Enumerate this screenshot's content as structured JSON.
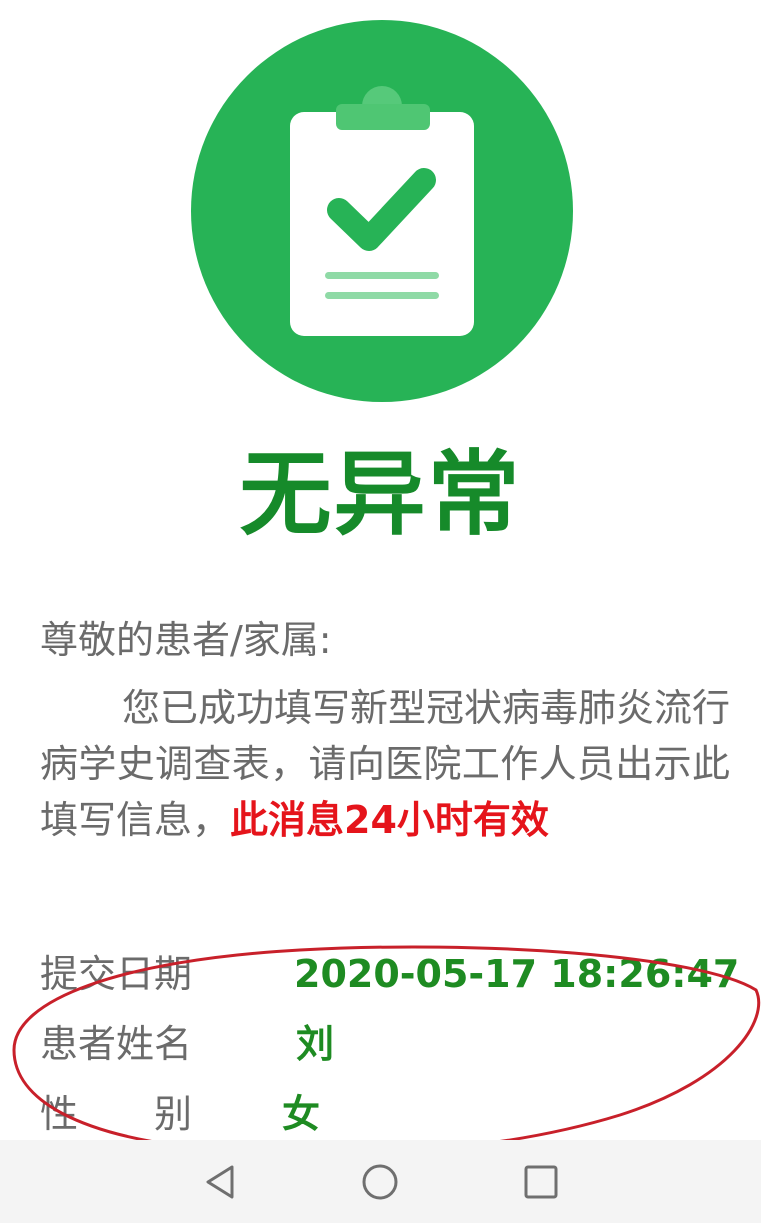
{
  "colors": {
    "status_green": "#27b356",
    "title_green": "#168a2a",
    "value_green": "#1e8b22",
    "alert_red": "#e5141b",
    "text_gray": "#6b6b6b",
    "annotation_red": "#c8202a",
    "nav_gray": "#6f6f6f"
  },
  "status": {
    "icon": "clipboard-check-icon",
    "title": "无异常"
  },
  "message": {
    "greeting": "尊敬的患者/家属:",
    "body": "您已成功填写新型冠状病毒肺炎流行病学史调查表，请向医院工作人员出示此填写信息，",
    "highlight": "此消息24小时有效"
  },
  "info": {
    "submit_date": {
      "label": "提交日期",
      "value": "2020-05-17 18:26:47"
    },
    "patient_name": {
      "label": "患者姓名",
      "value": "刘"
    },
    "gender": {
      "label_chars": [
        "性",
        "别"
      ],
      "value": "女"
    }
  },
  "nav": {
    "back": "back-triangle-icon",
    "home": "home-circle-icon",
    "recents": "recents-square-icon"
  }
}
